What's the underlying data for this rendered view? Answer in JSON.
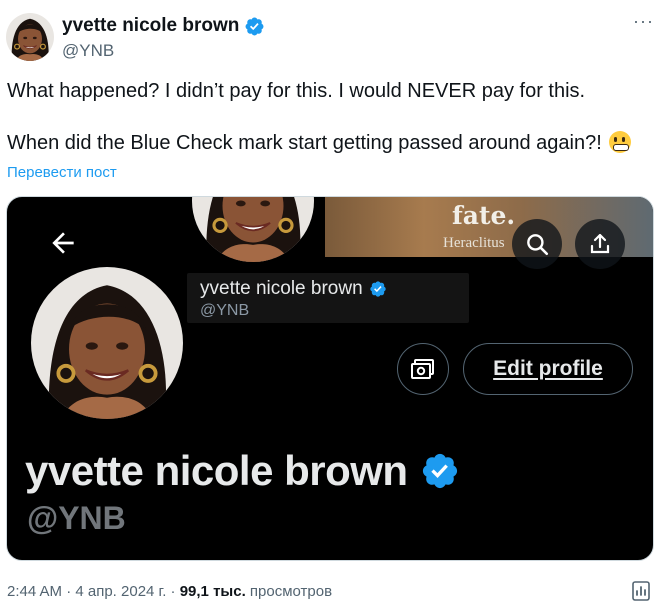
{
  "author": {
    "name": "yvette nicole brown",
    "handle": "@YNB"
  },
  "tweet": {
    "line1": "What happened? I didn’t pay for this. I would NEVER pay for this.",
    "line2": "When did the Blue Check mark start getting passed around again?!",
    "emoji_icon": "grimacing-face-icon"
  },
  "translate_label": "Перевести пост",
  "embedded_profile": {
    "banner_quote": "fate.",
    "banner_author": "Heraclitus",
    "overlay_name": "yvette nicole brown",
    "overlay_handle": "@YNB",
    "edit_profile_label": "Edit profile",
    "profile_name": "yvette nicole brown",
    "profile_handle": "@YNB"
  },
  "meta": {
    "time_date": "2:44 AM · 4 апр. 2024 г. · ",
    "views_count": "99,1 тыс.",
    "views_label": " просмотров"
  },
  "colors": {
    "verified": "#1d9bf0",
    "link": "#1d9bf0",
    "media_bg": "#000000"
  }
}
